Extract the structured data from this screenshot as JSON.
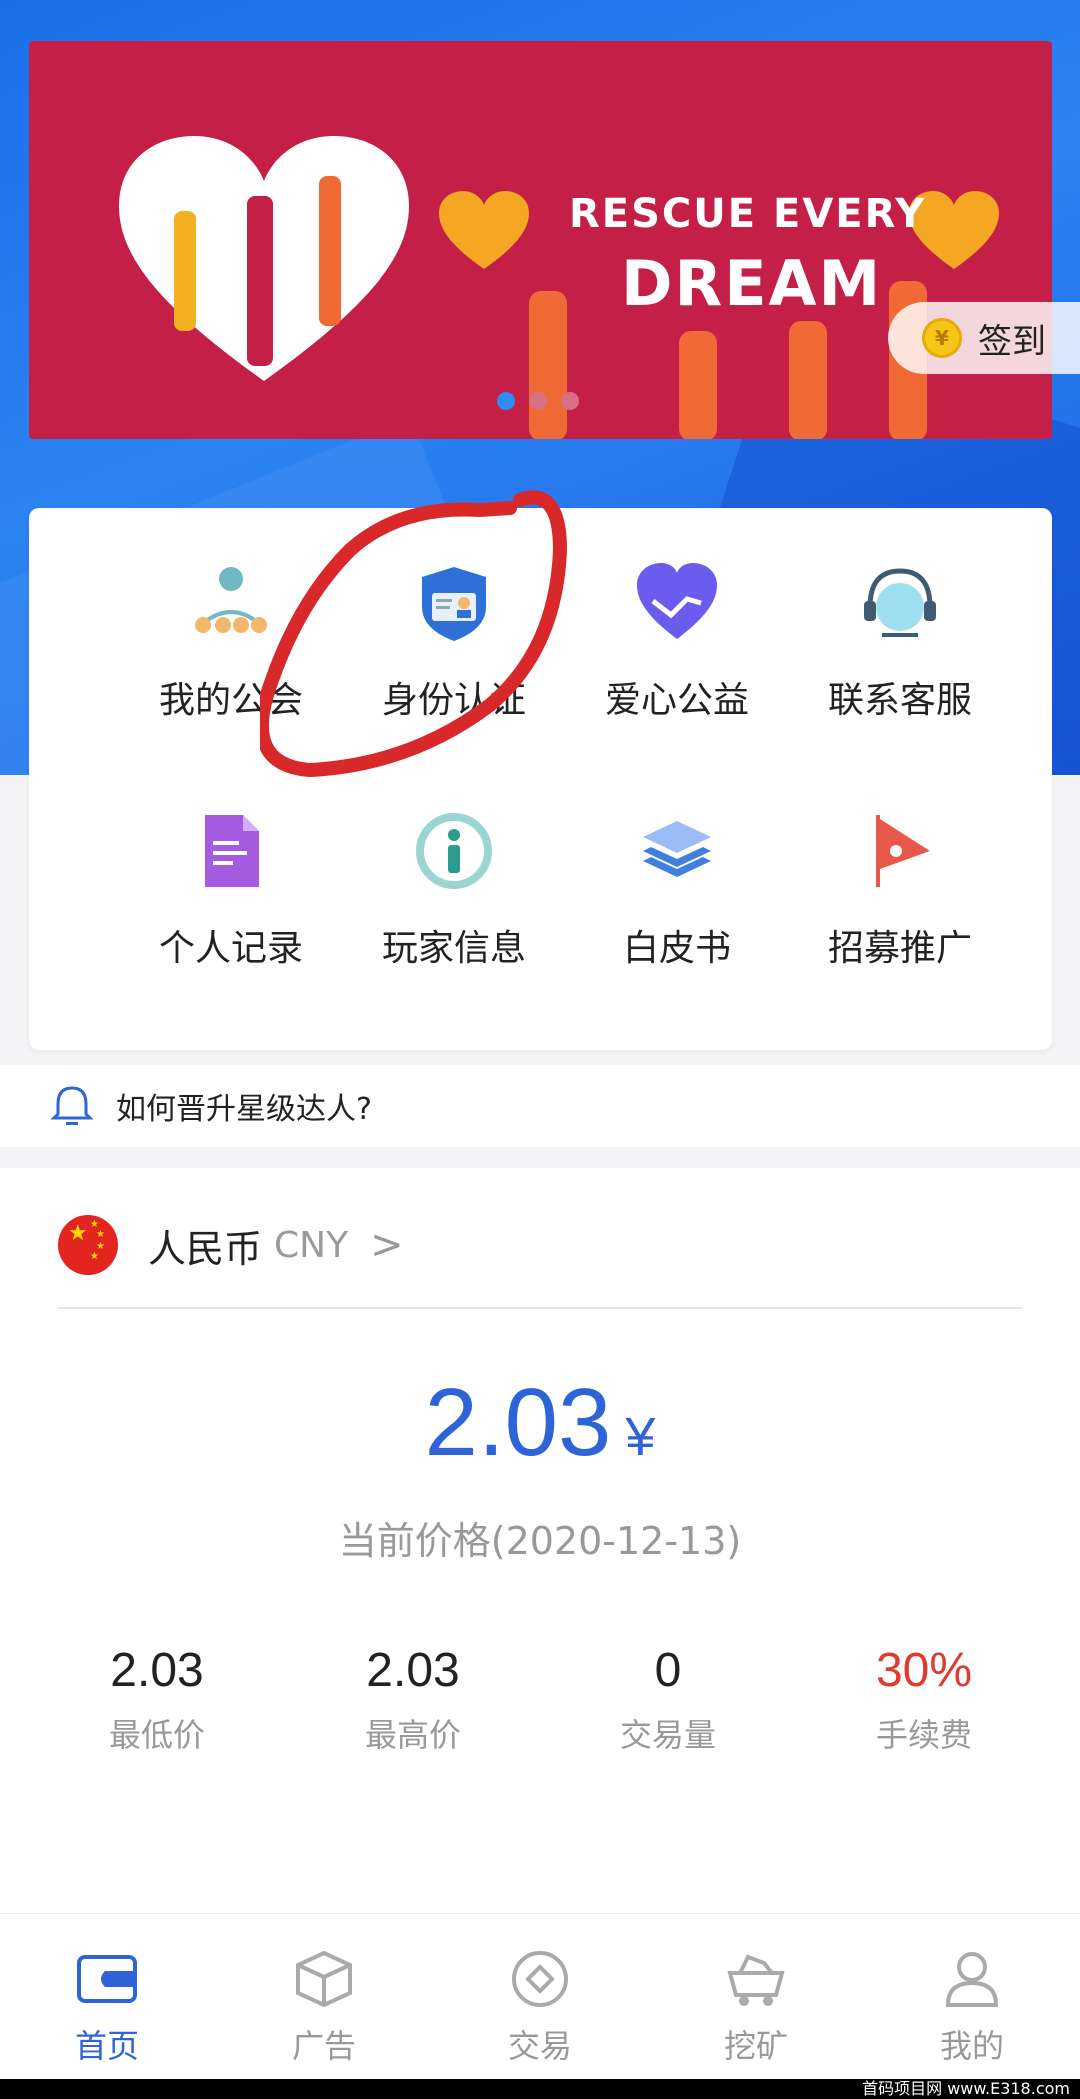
{
  "banner": {
    "title_line1": "RESCUE EVERY",
    "title_line2": "DREAM",
    "active_slide": 1,
    "slide_count": 3
  },
  "checkin": {
    "coin_symbol": "¥",
    "label": "签到"
  },
  "menu": {
    "items": [
      {
        "label": "我的公会",
        "icon": "guild-people-icon"
      },
      {
        "label": "身份认证",
        "icon": "id-shield-icon"
      },
      {
        "label": "爱心公益",
        "icon": "handshake-heart-icon"
      },
      {
        "label": "联系客服",
        "icon": "headset-icon"
      },
      {
        "label": "个人记录",
        "icon": "document-icon"
      },
      {
        "label": "玩家信息",
        "icon": "info-icon"
      },
      {
        "label": "白皮书",
        "icon": "layers-icon"
      },
      {
        "label": "招募推广",
        "icon": "flag-icon"
      }
    ]
  },
  "notice": {
    "text": "如何晋升星级达人?"
  },
  "price": {
    "currency_name": "人民币",
    "currency_code": "CNY",
    "current_value": "2.03",
    "unit": "¥",
    "date_label": "当前价格(2020-12-13)",
    "stats": [
      {
        "value": "2.03",
        "label": "最低价"
      },
      {
        "value": "2.03",
        "label": "最高价"
      },
      {
        "value": "0",
        "label": "交易量"
      },
      {
        "value": "30%",
        "label": "手续费"
      }
    ]
  },
  "tabs": [
    {
      "label": "首页",
      "icon": "wallet-icon",
      "active": true
    },
    {
      "label": "广告",
      "icon": "box-icon",
      "active": false
    },
    {
      "label": "交易",
      "icon": "exchange-icon",
      "active": false
    },
    {
      "label": "挖矿",
      "icon": "mining-cart-icon",
      "active": false
    },
    {
      "label": "我的",
      "icon": "user-icon",
      "active": false
    }
  ],
  "watermark": "首码项目网 www.E318.com",
  "colors": {
    "brand_blue": "#2f63d8",
    "banner_red": "#c41f46",
    "fee_red": "#e03b2e",
    "annotation_red": "#d8282a"
  }
}
